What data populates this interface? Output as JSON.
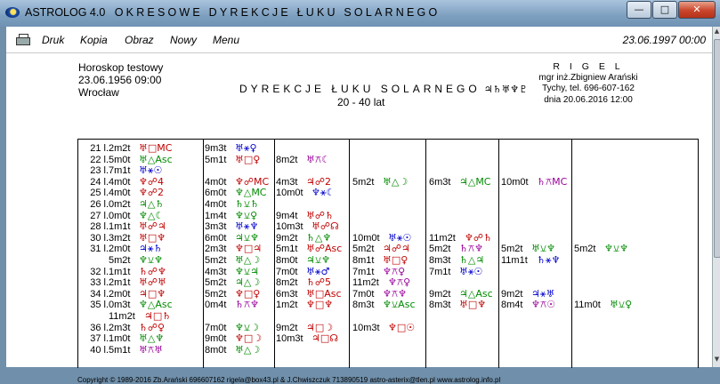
{
  "window": {
    "title_app": "ASTROLOG 4.0",
    "title_main": "OKRESOWE DYREKCJE ŁUKU SOLARNEGO",
    "minimize": "—",
    "maximize": "□",
    "close": "✕"
  },
  "menu": {
    "items": [
      "Druk",
      "Kopia",
      "Obraz",
      "Nowy",
      "Menu"
    ],
    "date": "23.06.1997  00:00"
  },
  "header": {
    "left": [
      "Horoskop testowy",
      "23.06.1956  09:00",
      "Wrocław"
    ],
    "title": "DYREKCJE  ŁUKU SOLARNEGO",
    "title_glyphs": "♃♄♅♆♇",
    "range": "20 - 40 lat",
    "right": [
      "R I G E L",
      "mgr inż.Zbigniew Arański",
      "Tychy, tel. 696-607-162",
      "dnia 20.06.2016  12:00"
    ]
  },
  "table": {
    "rows": [
      {
        "age": "21 l.",
        "c": [
          [
            "2m2t",
            "♅□MC"
          ],
          [
            "9m3t",
            "♅⚹♀"
          ],
          [
            "",
            ""
          ],
          [
            "",
            ""
          ],
          [
            "",
            ""
          ],
          [
            "",
            ""
          ],
          [
            "",
            ""
          ]
        ]
      },
      {
        "age": "22 l.",
        "c": [
          [
            "5m0t",
            "♅△Asc"
          ],
          [
            "5m1t",
            "♅□♀"
          ],
          [
            "8m2t",
            "♅⚻☾"
          ],
          [
            "",
            ""
          ],
          [
            "",
            ""
          ],
          [
            "",
            ""
          ],
          [
            "",
            ""
          ]
        ]
      },
      {
        "age": "23 l.",
        "c": [
          [
            "7m1t",
            "♅⚹☉"
          ],
          [
            "",
            ""
          ],
          [
            "",
            ""
          ],
          [
            "",
            ""
          ],
          [
            "",
            ""
          ],
          [
            "",
            ""
          ],
          [
            "",
            ""
          ]
        ]
      },
      {
        "age": "24 l.",
        "c": [
          [
            "4m0t",
            "♆☍4"
          ],
          [
            "4m0t",
            "♆☍MC"
          ],
          [
            "4m3t",
            "♃☍2"
          ],
          [
            "5m2t",
            "♅△☽"
          ],
          [
            "6m3t",
            "♃△MC"
          ],
          [
            "10m0t",
            "♄⚻MC"
          ],
          [
            "",
            ""
          ]
        ]
      },
      {
        "age": "25 l.",
        "c": [
          [
            "4m0t",
            "♆☍2"
          ],
          [
            "6m0t",
            "♆△MC"
          ],
          [
            "10m0t",
            "♆⚹☾"
          ],
          [
            "",
            ""
          ],
          [
            "",
            ""
          ],
          [
            "",
            ""
          ],
          [
            "",
            ""
          ]
        ]
      },
      {
        "age": "26 l.",
        "c": [
          [
            "0m2t",
            "♃△♄"
          ],
          [
            "4m0t",
            "♄⚺♄"
          ],
          [
            "",
            ""
          ],
          [
            "",
            ""
          ],
          [
            "",
            ""
          ],
          [
            "",
            ""
          ],
          [
            "",
            ""
          ]
        ]
      },
      {
        "age": "27 l.",
        "c": [
          [
            "0m0t",
            "♆△☾"
          ],
          [
            "1m4t",
            "♆⚺♀"
          ],
          [
            "9m4t",
            "♅☍♄"
          ],
          [
            "",
            ""
          ],
          [
            "",
            ""
          ],
          [
            "",
            ""
          ],
          [
            "",
            ""
          ]
        ]
      },
      {
        "age": "28 l.",
        "c": [
          [
            "1m1t",
            "♅☍♃"
          ],
          [
            "3m3t",
            "♅⚹♆"
          ],
          [
            "10m3t",
            "♅☍☊"
          ],
          [
            "",
            ""
          ],
          [
            "",
            ""
          ],
          [
            "",
            ""
          ],
          [
            "",
            ""
          ]
        ]
      },
      {
        "age": "30 l.",
        "c": [
          [
            "3m2t",
            "♅□♆"
          ],
          [
            "6m0t",
            "♃⚺♆"
          ],
          [
            "9m2t",
            "♄△♆"
          ],
          [
            "10m0t",
            "♅⚹☉"
          ],
          [
            "11m2t",
            "♆☍♄"
          ],
          [
            "",
            ""
          ],
          [
            "",
            ""
          ]
        ]
      },
      {
        "age": "31 l.",
        "c": [
          [
            "2m0t",
            "♃⚹♄"
          ],
          [
            "2m3t",
            "♆□♃"
          ],
          [
            "5m1t",
            "♅☍Asc"
          ],
          [
            "5m2t",
            "♃☍♃"
          ],
          [
            "5m2t",
            "♄⚻♆"
          ],
          [
            "5m2t",
            "♅⚺♆"
          ],
          [
            "5m2t",
            "♆⚺♆"
          ]
        ]
      },
      {
        "age": "",
        "c": [
          [
            "5m2t",
            "♆⚺♆"
          ],
          [
            "5m2t",
            "♅△☽"
          ],
          [
            "8m0t",
            "♃⚺♆"
          ],
          [
            "8m1t",
            "♅□♀"
          ],
          [
            "8m3t",
            "♄△♃"
          ],
          [
            "11m1t",
            "♄⚹♆"
          ],
          [
            "",
            ""
          ]
        ]
      },
      {
        "age": "32 l.",
        "c": [
          [
            "1m1t",
            "♄☍♆"
          ],
          [
            "4m3t",
            "♆⚺♃"
          ],
          [
            "7m0t",
            "♅⚹♂"
          ],
          [
            "7m1t",
            "♆⚻♀"
          ],
          [
            "7m1t",
            "♅⚹☉"
          ],
          [
            "",
            ""
          ],
          [
            "",
            ""
          ]
        ]
      },
      {
        "age": "33 l.",
        "c": [
          [
            "2m1t",
            "♅☍♅"
          ],
          [
            "5m2t",
            "♃△☽"
          ],
          [
            "8m2t",
            "♄☍5"
          ],
          [
            "11m2t",
            "♆⚻♀"
          ],
          [
            "",
            ""
          ],
          [
            "",
            ""
          ],
          [
            "",
            ""
          ]
        ]
      },
      {
        "age": "34 l.",
        "c": [
          [
            "2m0t",
            "♃□♆"
          ],
          [
            "5m2t",
            "♆□♀"
          ],
          [
            "6m3t",
            "♅□Asc"
          ],
          [
            "7m0t",
            "♆⚻♆"
          ],
          [
            "9m2t",
            "♃△Asc"
          ],
          [
            "9m2t",
            "♃⚹♅"
          ],
          [
            "",
            ""
          ]
        ]
      },
      {
        "age": "35 l.",
        "c": [
          [
            "0m3t",
            "♆△Asc"
          ],
          [
            "0m4t",
            "♄⚻♆"
          ],
          [
            "1m2t",
            "♆□♆"
          ],
          [
            "8m3t",
            "♆⚺Asc"
          ],
          [
            "8m3t",
            "♅□♆"
          ],
          [
            "8m4t",
            "♆⚻☉"
          ],
          [
            "11m0t",
            "♅⚺♀"
          ]
        ]
      },
      {
        "age": "",
        "c": [
          [
            "11m2t",
            "♃□♄"
          ],
          [
            "",
            ""
          ],
          [
            "",
            ""
          ],
          [
            "",
            ""
          ],
          [
            "",
            ""
          ],
          [
            "",
            ""
          ],
          [
            "",
            ""
          ]
        ]
      },
      {
        "age": "36 l.",
        "c": [
          [
            "2m3t",
            "♄☍♀"
          ],
          [
            "7m0t",
            "♆⚺☽"
          ],
          [
            "9m2t",
            "♃□☽"
          ],
          [
            "10m3t",
            "♆□☉"
          ],
          [
            "",
            ""
          ],
          [
            "",
            ""
          ],
          [
            "",
            ""
          ]
        ]
      },
      {
        "age": "37 l.",
        "c": [
          [
            "1m0t",
            "♅△♆"
          ],
          [
            "9m0t",
            "♆□☽"
          ],
          [
            "10m3t",
            "♃□☊"
          ],
          [
            "",
            ""
          ],
          [
            "",
            ""
          ],
          [
            "",
            ""
          ],
          [
            "",
            ""
          ]
        ]
      },
      {
        "age": "40 l.",
        "c": [
          [
            "5m1t",
            "♅⚻♅"
          ],
          [
            "8m0t",
            "♅△☽"
          ],
          [
            "",
            ""
          ],
          [
            "",
            ""
          ],
          [
            "",
            ""
          ],
          [
            "",
            ""
          ],
          [
            "",
            ""
          ]
        ]
      }
    ]
  },
  "footer": "Copyright © 1989-2016 Zb.Arański 696607162 rigela@box43.pl & J.Chwiszczuk 713890519 astro-asterix@tlen.pl www.astrolog.info.pl"
}
